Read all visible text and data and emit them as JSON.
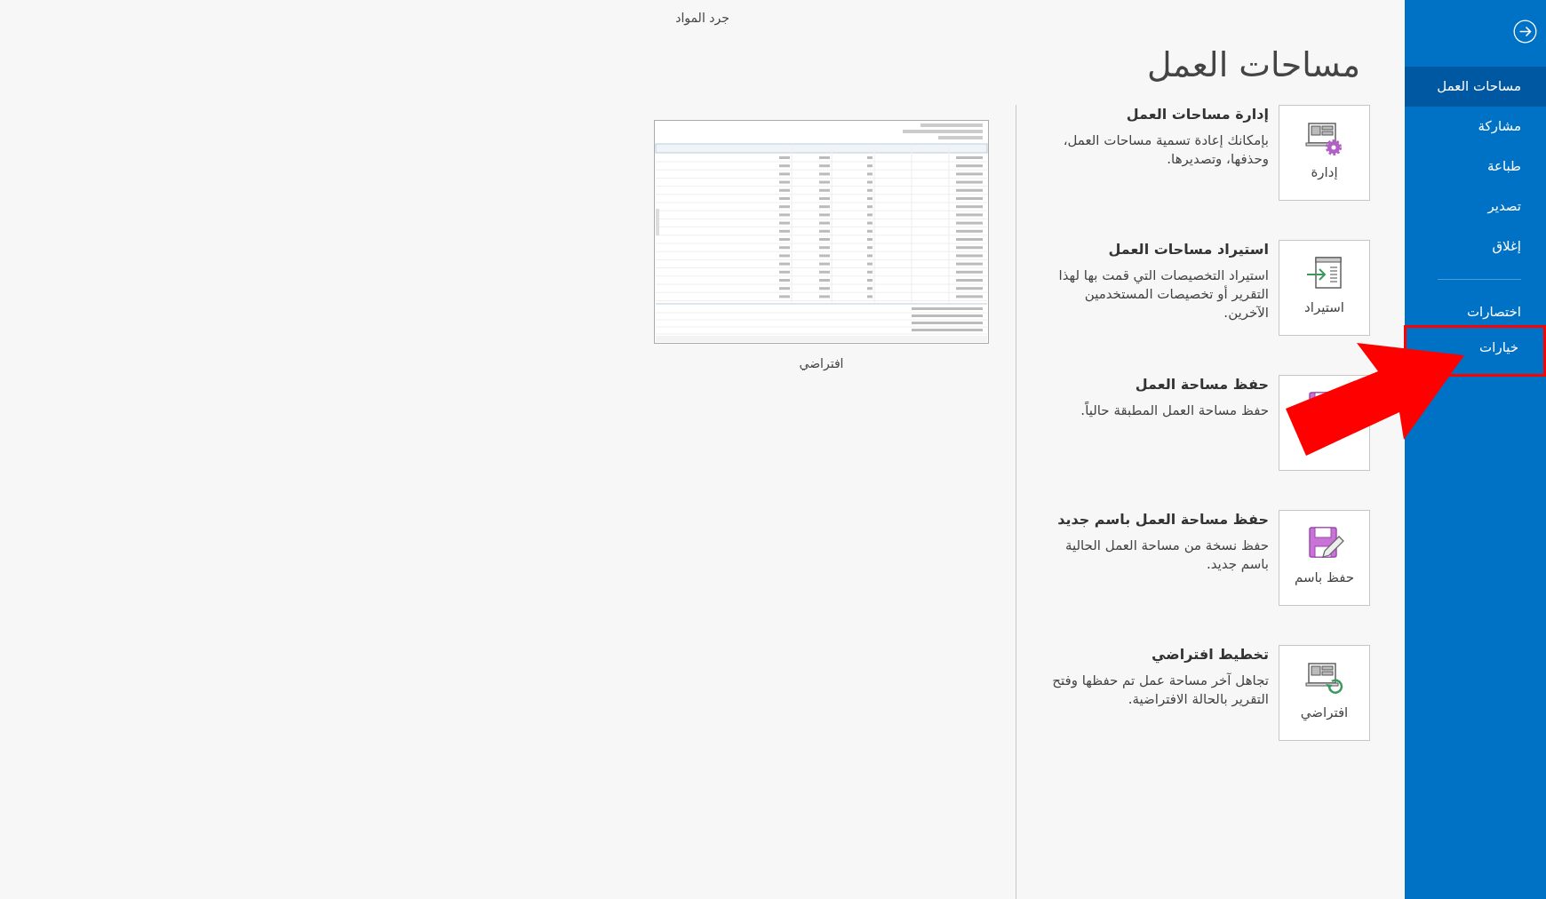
{
  "header": {
    "document_title": "جرد المواد"
  },
  "sidebar": {
    "items": [
      {
        "label": "مساحات العمل",
        "selected": true
      },
      {
        "label": "مشاركة",
        "selected": false
      },
      {
        "label": "طباعة",
        "selected": false
      },
      {
        "label": "تصدير",
        "selected": false
      },
      {
        "label": "إغلاق",
        "selected": false
      }
    ],
    "secondary_items": [
      {
        "label": "اختصارات",
        "selected": false
      },
      {
        "label": "خيارات",
        "selected": false
      }
    ]
  },
  "page_title": "مساحات العمل",
  "actions": [
    {
      "kind": "manage",
      "label": "إدارة",
      "title": "إدارة مساحات العمل",
      "description": "بإمكانك إعادة تسمية مساحات العمل، وحذفها، وتصديرها."
    },
    {
      "kind": "import",
      "label": "استيراد",
      "title": "استيراد مساحات العمل",
      "description": "استيراد التخصيصات التي قمت بها لهذا التقرير أو تخصيصات المستخدمين الآخرين."
    },
    {
      "kind": "save",
      "title": "حفظ مساحة العمل",
      "description": "حفظ مساحة العمل المطبقة حالياً."
    },
    {
      "kind": "save_as",
      "label": "حفظ باسم",
      "title": "حفظ مساحة العمل باسم جديد",
      "description": "حفظ نسخة من مساحة العمل الحالية باسم جديد."
    },
    {
      "kind": "default",
      "label": "افتراضي",
      "title": "تخطيط افتراضي",
      "description": "تجاهل آخر مساحة عمل تم حفظها وفتح التقرير بالحالة الافتراضية."
    }
  ],
  "preview": {
    "caption": "افتراضي"
  }
}
